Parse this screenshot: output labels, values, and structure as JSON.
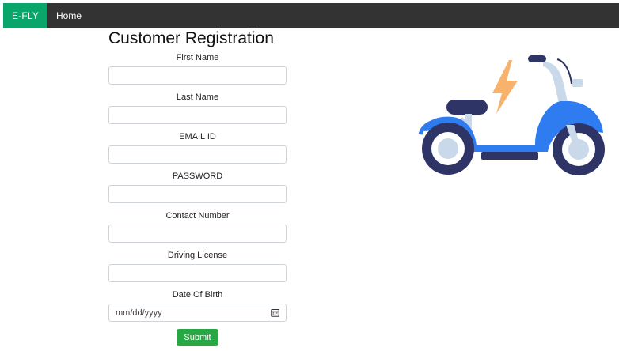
{
  "navbar": {
    "brand": "E-FLY",
    "links": [
      {
        "label": "Home"
      }
    ]
  },
  "form": {
    "title": "Customer Registration",
    "fields": [
      {
        "label": "First Name",
        "value": ""
      },
      {
        "label": "Last Name",
        "value": ""
      },
      {
        "label": "EMAIL ID",
        "value": ""
      },
      {
        "label": "PASSWORD",
        "value": ""
      },
      {
        "label": "Contact Number",
        "value": ""
      },
      {
        "label": "Driving License",
        "value": ""
      },
      {
        "label": "Date Of Birth",
        "placeholder": "mm/dd/yyyy"
      }
    ],
    "submit_label": "Submit"
  },
  "illustration": {
    "icon": "electric-scooter-icon",
    "colors": {
      "body": "#2f7bf0",
      "wheel": "#2e3465",
      "hub": "#c9d9ea",
      "bolt": "#f7b36b"
    }
  },
  "colors": {
    "navbar_bg": "#333333",
    "brand_bg": "#0aa56b",
    "submit_bg": "#28a745"
  }
}
